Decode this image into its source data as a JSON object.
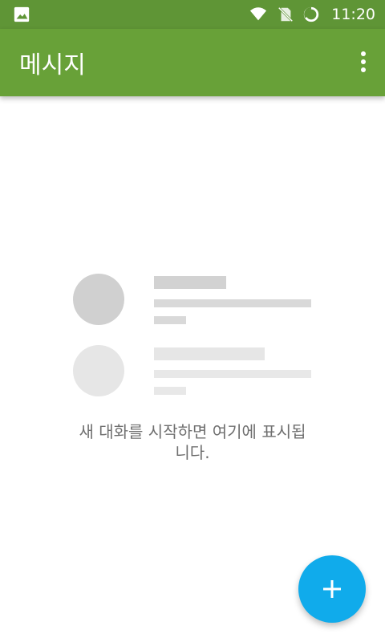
{
  "status_bar": {
    "time": "11:20",
    "icons": [
      "image-icon",
      "wifi-icon",
      "no-sim-icon",
      "battery-icon"
    ]
  },
  "app_bar": {
    "title": "메시지",
    "menu_icon": "more-vert-icon"
  },
  "empty_state": {
    "message_line1": "새 대화를 시작하면 여기에 표시됩",
    "message_line2": "니다."
  },
  "fab": {
    "icon": "plus-icon",
    "color": "#10abeb"
  },
  "colors": {
    "app_bar": "#68a138",
    "status_bar": "#5f9536"
  }
}
